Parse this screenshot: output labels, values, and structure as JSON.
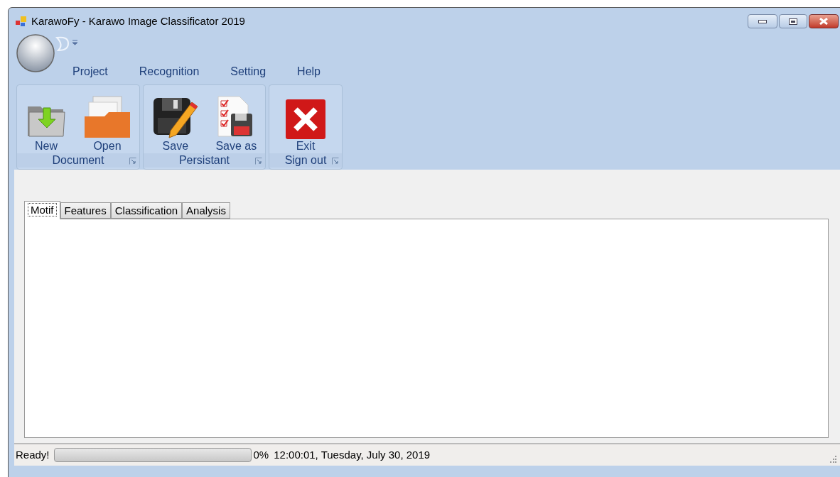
{
  "window": {
    "title": "KarawoFy - Karawo Image Classificator 2019"
  },
  "ribbon_tabs": [
    {
      "label": "Project"
    },
    {
      "label": "Recognition"
    },
    {
      "label": "Setting"
    },
    {
      "label": "Help"
    }
  ],
  "ribbon_groups": [
    {
      "title": "Document",
      "buttons": [
        {
          "label": "New",
          "kind": "new"
        },
        {
          "label": "Open",
          "kind": "open"
        }
      ]
    },
    {
      "title": "Persistant",
      "buttons": [
        {
          "label": "Save",
          "kind": "save"
        },
        {
          "label": "Save as",
          "kind": "saveas"
        }
      ]
    },
    {
      "title": "Sign out",
      "buttons": [
        {
          "label": "Exit",
          "kind": "exit"
        }
      ]
    }
  ],
  "tabs": [
    {
      "label": "Motif",
      "selected": true
    },
    {
      "label": "Features",
      "selected": false
    },
    {
      "label": "Classification",
      "selected": false
    },
    {
      "label": "Analysis",
      "selected": false
    }
  ],
  "status_bar": {
    "message": "Ready!",
    "progress": {
      "level": 0
    },
    "percent": "0%",
    "datetime": "12:00:01, Tuesday, July 30, 2019"
  }
}
